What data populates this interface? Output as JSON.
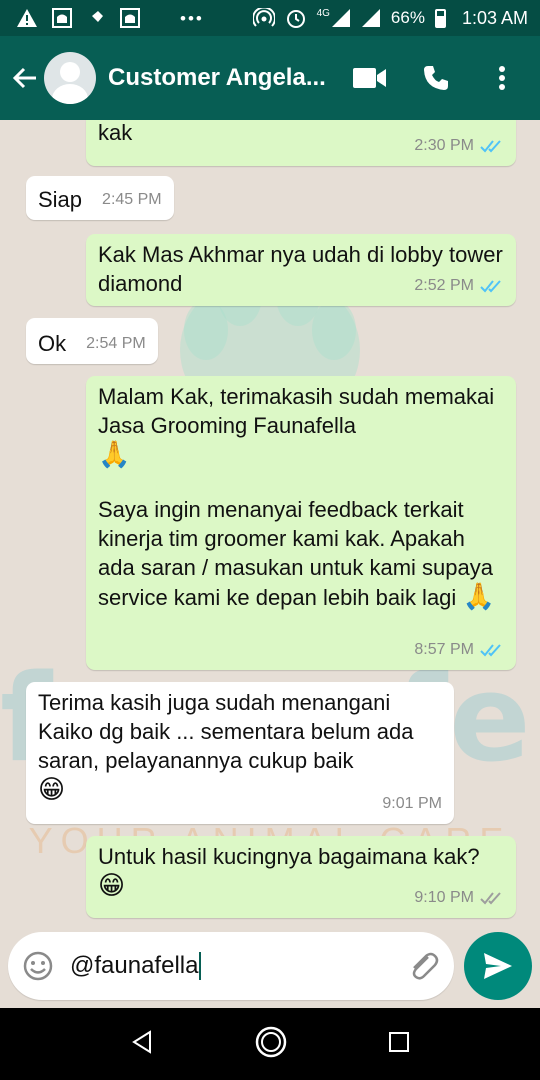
{
  "status_bar": {
    "network": "4G",
    "battery": "66%",
    "time": "1:03 AM"
  },
  "header": {
    "contact_name": "Customer Angela...",
    "icons": [
      "back-arrow-icon",
      "video-call-icon",
      "phone-icon",
      "more-options-icon"
    ]
  },
  "watermark": {
    "brand": "faunafella",
    "tagline": "YOUR ANIMAL CARE"
  },
  "messages": [
    {
      "dir": "out",
      "text": "kak",
      "time": "2:30 PM",
      "ticks": "read"
    },
    {
      "dir": "in",
      "text": "Siap",
      "time": "2:45 PM"
    },
    {
      "dir": "out",
      "text": "Kak Mas Akhmar nya udah di lobby tower diamond",
      "time": "2:52 PM",
      "ticks": "read"
    },
    {
      "dir": "in",
      "text": "Ok",
      "time": "2:54 PM"
    },
    {
      "dir": "out",
      "text": "Malam Kak, terimakasih sudah memakai Jasa Grooming Faunafella",
      "emoji": "🙏",
      "text2": "Saya ingin menanyai feedback terkait kinerja tim groomer kami kak. Apakah ada saran / masukan untuk kami supaya service kami ke depan lebih baik lagi",
      "emoji2": "🙏",
      "time": "8:57 PM",
      "ticks": "read"
    },
    {
      "dir": "in",
      "text": "Terima kasih juga sudah menangani Kaiko dg baik ... sementara belum ada saran, pelayanannya cukup baik",
      "emoji": "😁",
      "time": "9:01 PM"
    },
    {
      "dir": "out",
      "text": "Untuk hasil kucingnya bagaimana kak?",
      "emoji": "😁",
      "time": "9:10 PM",
      "ticks": "delivered"
    }
  ],
  "composer": {
    "value": "@faunafella",
    "icons": [
      "emoji-icon",
      "attach-icon",
      "send-icon"
    ]
  },
  "colors": {
    "header": "#075e54",
    "status_bar": "#054d44",
    "outgoing_bubble": "#dcf8c6",
    "incoming_bubble": "#ffffff",
    "read_ticks": "#4fc3f7",
    "send_button": "#00897b"
  }
}
